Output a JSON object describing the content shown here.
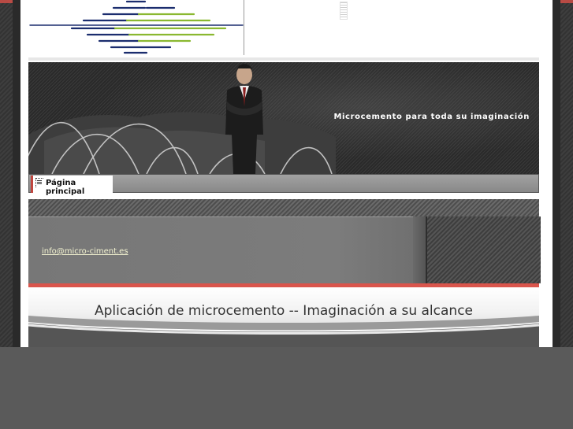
{
  "header": {
    "logo_icon": "striped-diamond-logo",
    "logo_colors": [
      "#1b2d6e",
      "#8ab830"
    ]
  },
  "banner": {
    "tagline": "Microcemento para toda su imaginación"
  },
  "nav": {
    "items": [
      {
        "label": "Página principal",
        "icon": "document-icon",
        "active": true
      }
    ]
  },
  "info": {
    "email": "info@micro-ciment.es"
  },
  "content": {
    "heading": "Aplicación de microcemento -- Imaginación a su alcance"
  },
  "colors": {
    "accent": "#d9554c",
    "email_link": "#f2f2d0"
  }
}
